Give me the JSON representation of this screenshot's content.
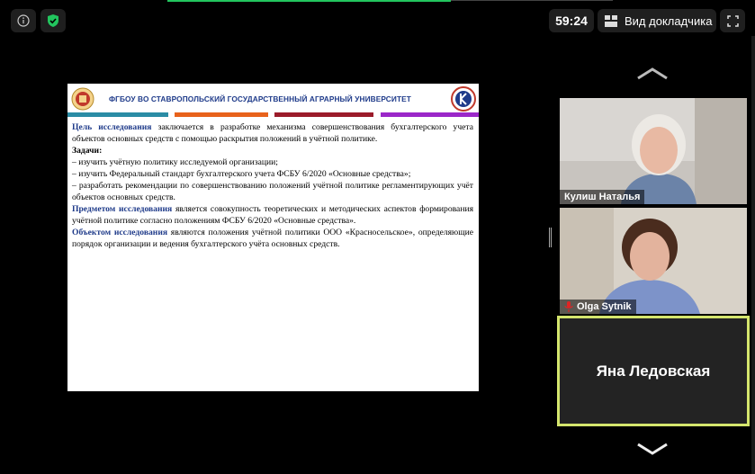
{
  "topbar": {
    "timer": "59:24",
    "view_label": "Вид докладчика",
    "icons": [
      "info-icon",
      "shield-check-icon",
      "view-grid-icon",
      "fullscreen-icon"
    ]
  },
  "slide": {
    "university": "ФГБОУ ВО СТАВРОПОЛЬСКИЙ ГОСУДАРСТВЕННЫЙ АГРАРНЫЙ УНИВЕРСИТЕТ",
    "stripe_colors": [
      "#2a8ca5",
      "#e8621b",
      "#9b1b2a",
      "#9b27c9"
    ],
    "goal_lead": "Цель исследования",
    "goal_text": " заключается в разработке механизма совершенствования бухгалтерского учета объектов основных средств с помощью раскрытия положений в учётной политике.",
    "tasks_title": "Задачи:",
    "tasks": [
      "–     изучить учётную политику исследуемой организации;",
      "–     изучить Федеральный стандарт бухгалтерского учета ФСБУ 6/2020 «Основные средства»;",
      "–     разработать рекомендации по совершенствованию положений учётной политике регламентирующих учёт объектов основных средств."
    ],
    "subject_lead": "Предметом исследования",
    "subject_text": " является совокупность теоретических и методических аспектов формирования учётной политике согласно положениям ФСБУ 6/2020 «Основные средства».",
    "object_lead": "Объектом исследования",
    "object_text": " являются положения учётной политики ООО «Красносельское», определяющие порядок организации и ведения бухгалтерского учёта основных средств."
  },
  "participants": [
    {
      "name": "Кулиш Наталья",
      "muted": false
    },
    {
      "name": "Olga Sytnik",
      "muted": true
    },
    {
      "name": "Яна Ледовская",
      "active_speaker": true
    }
  ],
  "colors": {
    "active_border": "#d4e56d",
    "accent_green": "#22c55e",
    "muted_red": "#e02424"
  }
}
